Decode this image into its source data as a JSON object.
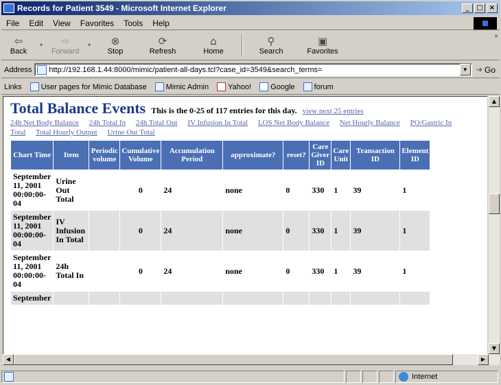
{
  "window": {
    "title": "Records for Patient 3549 - Microsoft Internet Explorer",
    "controls": [
      "_",
      "□",
      "×"
    ]
  },
  "menu": {
    "items": [
      "File",
      "Edit",
      "View",
      "Favorites",
      "Tools",
      "Help"
    ]
  },
  "toolbar": {
    "back": {
      "label": "Back",
      "icon": "back-arrow-icon",
      "glyph": "⇦"
    },
    "forward": {
      "label": "Forward",
      "icon": "forward-arrow-icon",
      "glyph": "⇨"
    },
    "stop": {
      "label": "Stop",
      "icon": "stop-icon",
      "glyph": "⊗"
    },
    "refresh": {
      "label": "Refresh",
      "icon": "refresh-icon",
      "glyph": "⟳"
    },
    "home": {
      "label": "Home",
      "icon": "home-icon",
      "glyph": "⌂"
    },
    "search": {
      "label": "Search",
      "icon": "search-icon",
      "glyph": "⚲"
    },
    "favorites": {
      "label": "Favorites",
      "icon": "favorites-icon",
      "glyph": "▣"
    },
    "dropdown_glyph": "▾",
    "close_glyph": "×"
  },
  "address": {
    "label": "Address",
    "url": "http://192.168.1.44:8000/mimic/patient-all-days.tcl?case_id=3549&search_terms=",
    "go_label": "Go",
    "go_glyph": "➜",
    "dropdown_glyph": "▼"
  },
  "links_bar": {
    "label": "Links",
    "items": [
      "User pages for Mimic Database",
      "Mimic Admin",
      "Yahoo!",
      "Google",
      "forum"
    ]
  },
  "page": {
    "heading": "Total Balance Events",
    "entries_text": "This is the 0-25 of 117 entries for this day.",
    "view_next": "view next 25 entries",
    "category_links": [
      "24h Net Body Balance",
      "24h Total In",
      "24h Total Out",
      "IV Infusion In Total",
      "LOS Net Body Balance",
      "Net Hourly Balance",
      "PO/Gastric In Total",
      "Total Hourly Output",
      "Urine Out Total"
    ]
  },
  "table": {
    "headers": [
      "Chart Time",
      "Item",
      "Periodic volume",
      "Cumulative Volume",
      "Accumulation Period",
      "approximate?",
      "reset?",
      "Care Giver ID",
      "Care Unit",
      "Transaction ID",
      "Element ID"
    ],
    "rows": [
      [
        "September 11, 2001 00:00:00-04",
        "Urine Out Total",
        "",
        "0",
        "24",
        "none",
        "0",
        "330",
        "1",
        "39",
        "1"
      ],
      [
        "September 11, 2001 00:00:00-04",
        "IV Infusion In Total",
        "",
        "0",
        "24",
        "none",
        "0",
        "330",
        "1",
        "39",
        "1"
      ],
      [
        "September 11, 2001 00:00:00-04",
        "24h Total In",
        "",
        "0",
        "24",
        "none",
        "0",
        "330",
        "1",
        "39",
        "1"
      ],
      [
        "September",
        "",
        "",
        "",
        "",
        "",
        "",
        "",
        "",
        "",
        ""
      ]
    ]
  },
  "status_bar": {
    "zone": "Internet"
  },
  "scrollbars": {
    "up_glyph": "▲",
    "down_glyph": "▼",
    "left_glyph": "◀",
    "right_glyph": "▶"
  }
}
